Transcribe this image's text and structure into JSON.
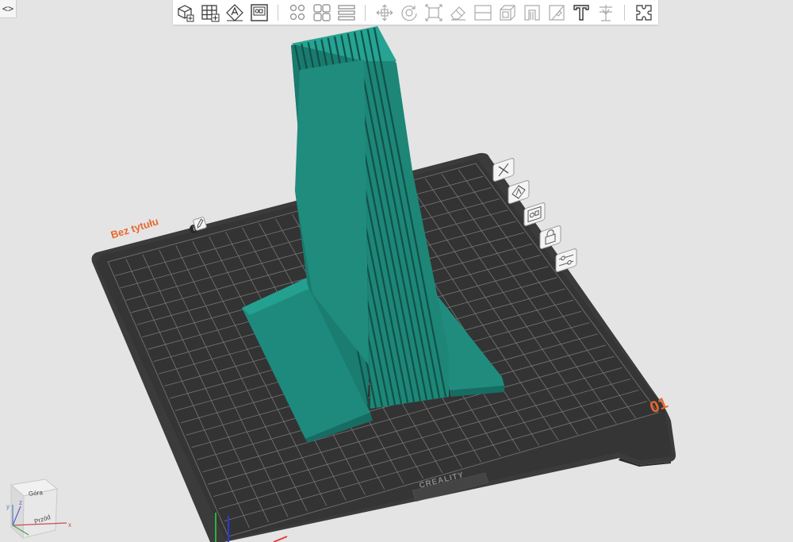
{
  "window": {
    "collapse_label": "<>"
  },
  "toolbar": {
    "groups": [
      [
        "add-object-icon",
        "add-plate-icon",
        "auto-arrange-icon",
        "plate-layout-icon"
      ],
      [
        "dot-grid-icon",
        "split-plates-icon",
        "layers-icon"
      ],
      [
        "move-icon",
        "rotate-icon",
        "scale-icon",
        "erase-icon",
        "cut-icon",
        "mirror-icon",
        "support-icon",
        "seam-icon",
        "text-icon",
        "measure-icon"
      ],
      [
        "puzzle-icon"
      ]
    ]
  },
  "plate": {
    "name": "Bez tytułu",
    "number": "01",
    "brand": "CREALITY",
    "actions": [
      "delete-plate-icon",
      "auto-arrange-plate-icon",
      "plate-layout-plate-icon",
      "lock-plate-icon",
      "plate-settings-icon"
    ]
  },
  "view_cube": {
    "top_label": "Góra",
    "front_label": "Przód",
    "axis_x": "x",
    "axis_y": "y",
    "axis_z": "z"
  },
  "colors": {
    "background": "#e4e4e4",
    "plate": "#3a3a3a",
    "model": "#1f8c7e",
    "accent": "#e8682e"
  }
}
